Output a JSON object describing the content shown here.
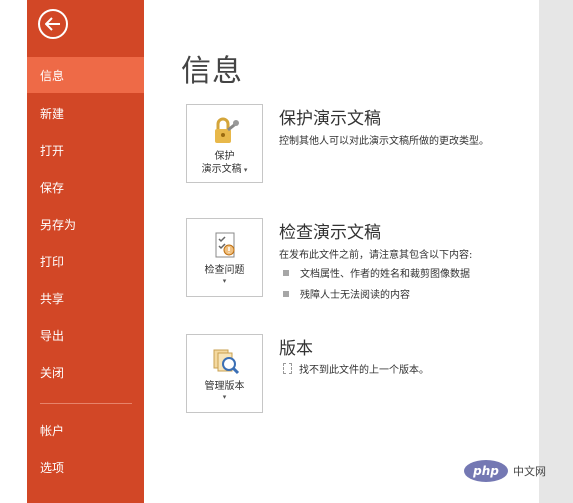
{
  "sidebar": {
    "items": [
      {
        "label": "信息",
        "active": true
      },
      {
        "label": "新建"
      },
      {
        "label": "打开"
      },
      {
        "label": "保存"
      },
      {
        "label": "另存为"
      },
      {
        "label": "打印"
      },
      {
        "label": "共享"
      },
      {
        "label": "导出"
      },
      {
        "label": "关闭"
      },
      {
        "label": "帐户"
      },
      {
        "label": "选项"
      }
    ]
  },
  "main": {
    "title": "信息",
    "sections": [
      {
        "button_line1": "保护",
        "button_line2": "演示文稿",
        "title": "保护演示文稿",
        "description": "控制其他人可以对此演示文稿所做的更改类型。"
      },
      {
        "button_line1": "检查问题",
        "title": "检查演示文稿",
        "description": "在发布此文件之前，请注意其包含以下内容:",
        "bullets": [
          "文档属性、作者的姓名和裁剪图像数据",
          "残障人士无法阅读的内容"
        ]
      },
      {
        "button_line1": "管理版本",
        "title": "版本",
        "description": "找不到此文件的上一个版本。"
      }
    ]
  },
  "watermark": {
    "logo": "php",
    "text": "中文网"
  },
  "colors": {
    "sidebar_bg": "#d24726",
    "sidebar_active": "#ee6a47"
  }
}
